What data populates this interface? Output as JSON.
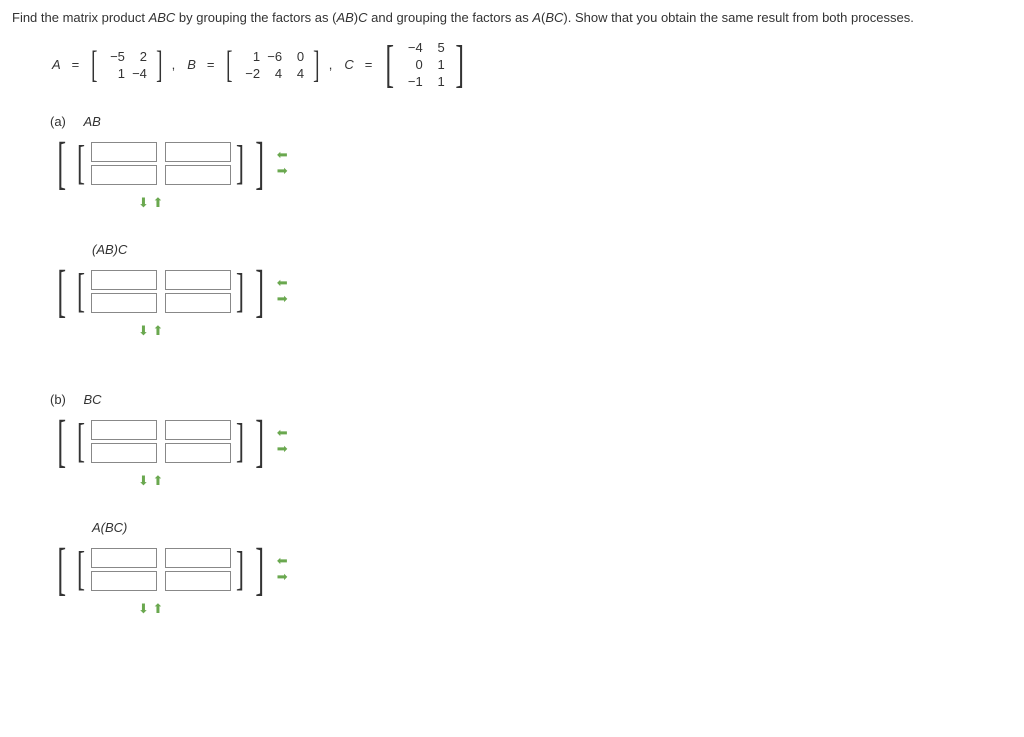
{
  "problem": {
    "text_pre": "Find the matrix product ",
    "abc": "ABC",
    "text_mid1": " by grouping the factors as (",
    "ab": "AB",
    "text_mid2": ")",
    "c1": "C",
    "text_mid3": " and grouping the factors as ",
    "a1": "A",
    "text_mid4": "(",
    "bc": "BC",
    "text_end": "). Show that you obtain the same result from both processes."
  },
  "matrices": {
    "A": {
      "label": "A",
      "eq": "=",
      "rows": [
        [
          "−5",
          "2"
        ],
        [
          "1",
          "−4"
        ]
      ]
    },
    "B": {
      "label": "B",
      "eq": "=",
      "rows": [
        [
          "1",
          "−6",
          "0"
        ],
        [
          "−2",
          "4",
          "4"
        ]
      ]
    },
    "C": {
      "label": "C",
      "eq": "=",
      "rows": [
        [
          "−4",
          "5"
        ],
        [
          "0",
          "1"
        ],
        [
          "−1",
          "1"
        ]
      ]
    },
    "comma": ","
  },
  "parts": {
    "a": {
      "tag": "(a)",
      "label1": "AB",
      "label2": "(AB)C"
    },
    "b": {
      "tag": "(b)",
      "label1": "BC",
      "label2": "A(BC)"
    }
  },
  "arrows": {
    "left": "⬅",
    "right": "➡",
    "down": "⬇",
    "up": "⬆"
  }
}
